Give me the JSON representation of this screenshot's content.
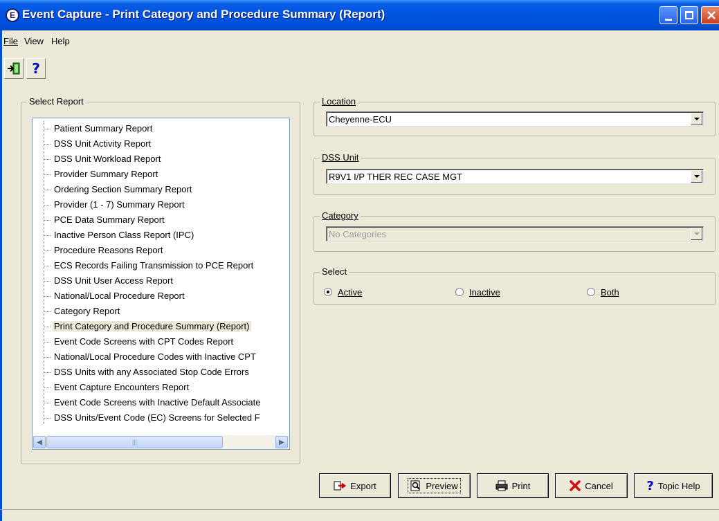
{
  "window": {
    "title": "Event Capture - Print Category and Procedure Summary (Report)"
  },
  "menu": [
    "File",
    "View",
    "Help"
  ],
  "toolbar": {
    "help_label": "?"
  },
  "select_report": {
    "label": "Select Report",
    "items": [
      "Patient Summary Report",
      "DSS Unit Activity Report",
      "DSS Unit Workload Report",
      "Provider Summary Report",
      "Ordering Section Summary Report",
      "Provider (1 - 7) Summary Report",
      "PCE Data Summary Report",
      "Inactive Person Class Report (IPC)",
      "Procedure Reasons Report",
      "ECS Records Failing Transmission to PCE Report",
      "DSS Unit User Access Report",
      "National/Local Procedure Report",
      "Category Report",
      "Print Category and Procedure Summary (Report)",
      "Event Code Screens with CPT Codes Report",
      "National/Local Procedure Codes with Inactive CPT",
      "DSS Units with any Associated Stop Code Errors",
      "Event Capture Encounters Report",
      "Event Code Screens with Inactive Default Associate",
      "DSS Units/Event Code (EC) Screens for Selected F"
    ],
    "selected_index": 13,
    "scrollbar_grip": "|||"
  },
  "location": {
    "label": "Location",
    "value": "Cheyenne-ECU"
  },
  "dss_unit": {
    "label": "DSS Unit",
    "value": "R9V1 I/P THER REC CASE MGT"
  },
  "category": {
    "label": "Category",
    "value": "No Categories"
  },
  "select": {
    "label": "Select",
    "options": [
      "Active",
      "Inactive",
      "Both"
    ],
    "selected": "Active"
  },
  "buttons": {
    "export": "Export",
    "preview": "Preview",
    "print": "Print",
    "cancel": "Cancel",
    "topic_help": "Topic Help"
  },
  "icons": {
    "exit": "exit-door-icon",
    "help": "question-icon",
    "export": "export-icon",
    "preview": "magnifier-icon",
    "print": "printer-icon",
    "cancel": "red-x-icon",
    "topic_help": "question-icon"
  },
  "colors": {
    "titlebar": "#0054e3",
    "close_button": "#c8401e",
    "cancel_x": "#d01010",
    "help_q": "#0000c0"
  }
}
